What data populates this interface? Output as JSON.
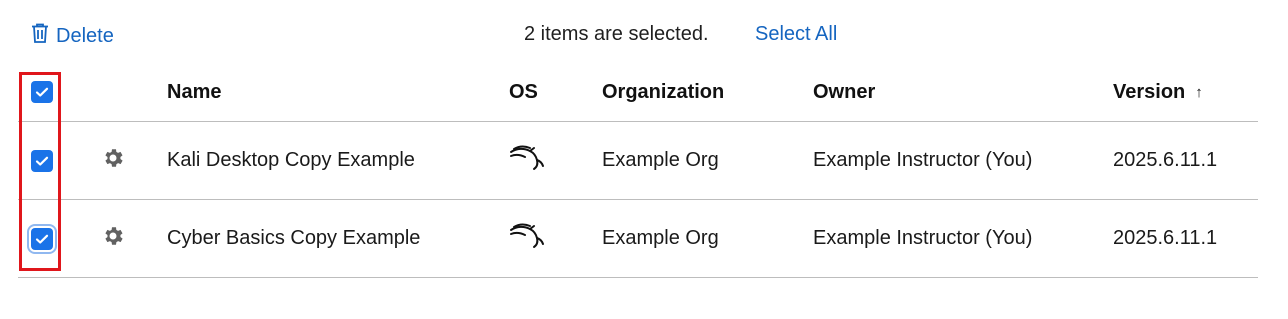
{
  "toolbar": {
    "delete_label": "Delete",
    "selection_status": "2 items are selected.",
    "select_all_label": "Select All"
  },
  "table": {
    "columns": {
      "name": "Name",
      "os": "OS",
      "organization": "Organization",
      "owner": "Owner",
      "version": "Version",
      "version_sort_indicator": "↑"
    },
    "header_checkbox_checked": true,
    "rows": [
      {
        "checked": true,
        "settings_icon": "gear-icon",
        "name": "Kali Desktop Copy Example",
        "os_icon": "kali-linux-dragon-icon",
        "organization": "Example Org",
        "owner": "Example Instructor (You)",
        "version": "2025.6.11.1"
      },
      {
        "checked": true,
        "settings_icon": "gear-icon",
        "name": "Cyber Basics Copy Example",
        "os_icon": "kali-linux-dragon-icon",
        "organization": "Example Org",
        "owner": "Example Instructor (You)",
        "version": "2025.6.11.1"
      }
    ]
  },
  "colors": {
    "accent": "#1565c0",
    "checkbox": "#1a73e8",
    "highlight": "#e0161b"
  }
}
